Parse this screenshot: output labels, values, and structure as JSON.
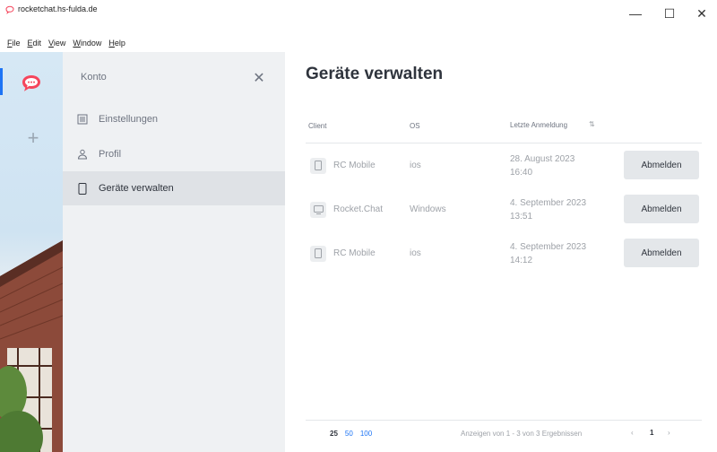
{
  "window": {
    "title": "rocketchat.hs-fulda.de",
    "minimize_glyph": "—",
    "maximize_glyph": "☐",
    "close_glyph": "✕"
  },
  "menubar": [
    {
      "label": "File",
      "accel": "F",
      "rest": "ile"
    },
    {
      "label": "Edit",
      "accel": "E",
      "rest": "dit"
    },
    {
      "label": "View",
      "accel": "V",
      "rest": "iew"
    },
    {
      "label": "Window",
      "accel": "W",
      "rest": "indow"
    },
    {
      "label": "Help",
      "accel": "H",
      "rest": "elp"
    }
  ],
  "rail": {
    "add_glyph": "+",
    "brand_color": "#f5455c"
  },
  "sidebar": {
    "title": "Konto",
    "close_glyph": "✕",
    "items": [
      {
        "label": "Einstellungen",
        "icon": "settings-list-icon"
      },
      {
        "label": "Profil",
        "icon": "user-icon"
      },
      {
        "label": "Geräte verwalten",
        "icon": "mobile-icon",
        "active": true
      }
    ]
  },
  "main": {
    "title": "Geräte verwalten",
    "columns": {
      "client": "Client",
      "os": "OS",
      "last_login": "Letzte Anmeldung"
    },
    "devices": [
      {
        "client": "RC Mobile",
        "os": "ios",
        "last_login": "28. August 2023 16:40",
        "icon": "mobile-icon",
        "action": "Abmelden"
      },
      {
        "client": "Rocket.Chat",
        "os": "Windows",
        "last_login": "4. September 2023 13:51",
        "icon": "desktop-icon",
        "action": "Abmelden"
      },
      {
        "client": "RC Mobile",
        "os": "ios",
        "last_login": "4. September 2023 14:12",
        "icon": "mobile-icon",
        "action": "Abmelden"
      }
    ],
    "pagination": {
      "page_sizes": [
        "25",
        "50",
        "100"
      ],
      "selected_page_size": "25",
      "range_text": "Anzeigen von 1 - 3 von 3 Ergebnissen",
      "prev": "‹",
      "current_page": "1",
      "next": "›"
    }
  },
  "colors": {
    "accent": "#1d74f5",
    "sidebar_bg": "#eff1f3",
    "active_item_bg": "#dfe2e6",
    "button_bg": "#e4e7ea"
  }
}
